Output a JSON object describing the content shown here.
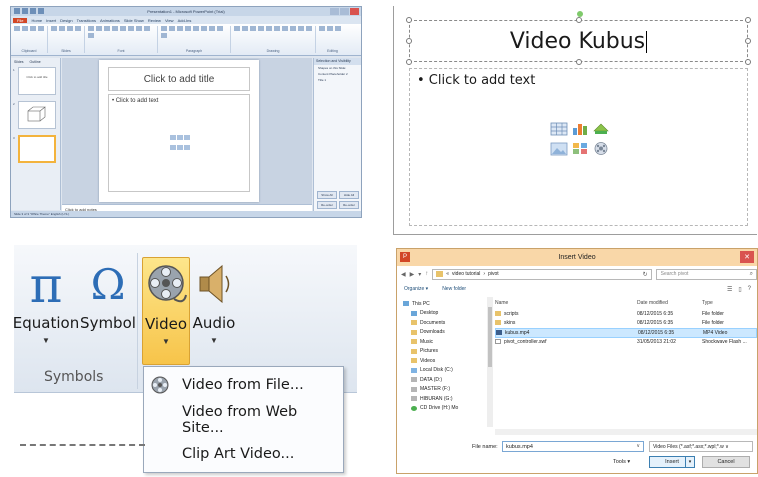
{
  "p1": {
    "window_title": "Presentation1 - Microsoft PowerPoint (Trial)",
    "tabs": [
      "File",
      "Home",
      "Insert",
      "Design",
      "Transitions",
      "Animations",
      "Slide Show",
      "Review",
      "View",
      "Add-Ins"
    ],
    "ribbon_groups": [
      "Clipboard",
      "Slides",
      "Font",
      "Paragraph",
      "Drawing",
      "Editing"
    ],
    "pane_tabs": [
      "Slides",
      "Outline"
    ],
    "thumb1_text": "Click to add title",
    "slide_title": "Click to add title",
    "slide_body": "• Click to add text",
    "notes": "Click to add notes",
    "right_pane": {
      "header": "Selection and Visibility",
      "subheader": "Shapes on this Slide:",
      "items": [
        "Content Placeholder 2",
        "Title 1"
      ],
      "buttons": [
        "Show All",
        "Hide All",
        "Re-order",
        "Re-order"
      ]
    },
    "status": "Slide 3 of 3   \"Office Theme\"   English (U.S.)"
  },
  "p2": {
    "title": "Video Kubus",
    "bullet": "• Click to add text"
  },
  "p3": {
    "buttons": [
      {
        "glyph": "π",
        "label": "Equation"
      },
      {
        "glyph": "Ω",
        "label": "Symbol"
      },
      {
        "label": "Video"
      },
      {
        "label": "Audio"
      }
    ],
    "group_label": "Symbols",
    "menu": [
      "Video from File...",
      "Video from Web Site...",
      "Clip Art Video..."
    ]
  },
  "p4": {
    "title": "Insert Video",
    "app_icon": "P",
    "path": [
      "«",
      "video tutorial",
      "›",
      "pivot"
    ],
    "search_placeholder": "Search pivot",
    "organize": "Organize ▾",
    "new_folder": "New folder",
    "nav_items": [
      "This PC",
      "Desktop",
      "Documents",
      "Downloads",
      "Music",
      "Pictures",
      "Videos",
      "Local Disk (C:)",
      "DATA (D:)",
      "MASTER (F:)",
      "HIBURAN (G:)",
      "CD Drive (H:) Mo"
    ],
    "columns": [
      "Name",
      "Date modified",
      "Type"
    ],
    "files": [
      {
        "name": "scripts",
        "date": "08/12/2015 6:35",
        "type": "File folder"
      },
      {
        "name": "skins",
        "date": "08/12/2015 6:35",
        "type": "File folder"
      },
      {
        "name": "kubus.mp4",
        "date": "08/12/2015 6:35",
        "type": "MP4 Video"
      },
      {
        "name": "pivot_controller.swf",
        "date": "31/05/2013 21:02",
        "type": "Shockwave Flash ..."
      }
    ],
    "filename_label": "File name:",
    "filename_value": "kubus.mp4",
    "filetype": "Video Files (*.asf;*.asx;*.wpl;*.w ∨",
    "tools": "Tools  ▾",
    "insert": "Insert",
    "cancel": "Cancel"
  }
}
